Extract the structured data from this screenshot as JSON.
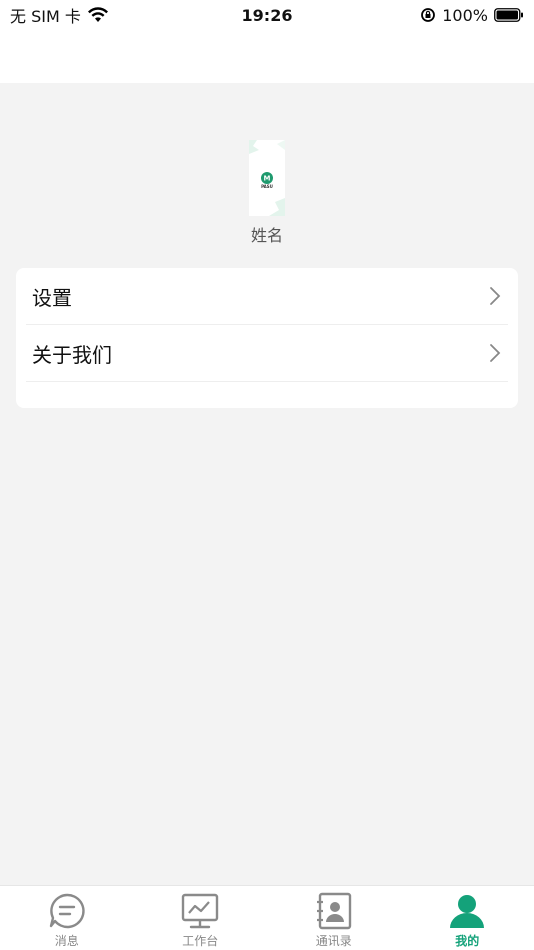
{
  "status_bar": {
    "carrier": "无 SIM 卡",
    "time": "19:26",
    "battery": "100%"
  },
  "profile": {
    "name": "姓名",
    "logo_text": "PASU"
  },
  "menu": {
    "items": [
      {
        "label": "设置"
      },
      {
        "label": "关于我们"
      }
    ]
  },
  "tabs": [
    {
      "label": "消息",
      "icon": "message-icon",
      "active": false
    },
    {
      "label": "工作台",
      "icon": "workbench-icon",
      "active": false
    },
    {
      "label": "通讯录",
      "icon": "contacts-icon",
      "active": false
    },
    {
      "label": "我的",
      "icon": "profile-icon",
      "active": true
    }
  ],
  "colors": {
    "accent": "#14a27a",
    "inactive": "#888888",
    "background": "#f3f3f3"
  }
}
